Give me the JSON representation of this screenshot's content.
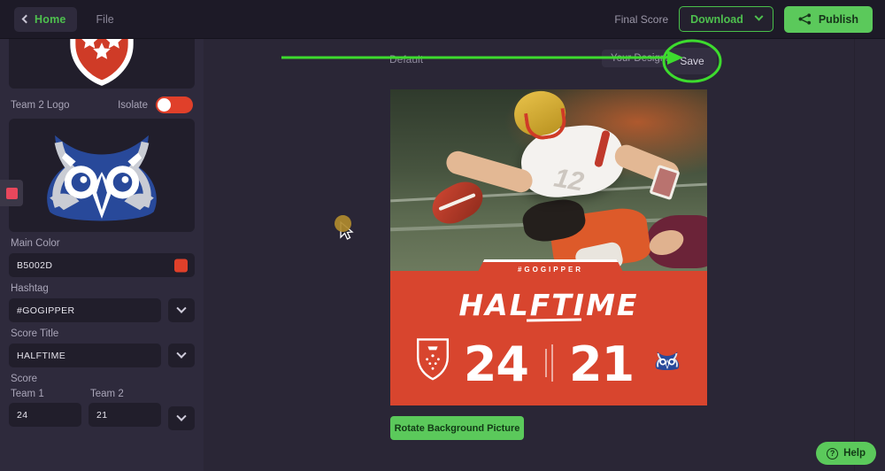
{
  "topbar": {
    "back_icon": "chevron-left-icon",
    "home_label": "Home",
    "file_label": "File",
    "final_score_label": "Final Score",
    "download_label": "Download",
    "download_caret_icon": "chevron-down-icon",
    "publish_label": "Publish",
    "publish_icon": "share-icon",
    "accent_green": "#4ec04e",
    "publish_bg": "#5bc95b"
  },
  "sidebar": {
    "team1_logo_alt": "red-shield-with-stars",
    "team2_logo_label": "Team 2 Logo",
    "isolate_label": "Isolate",
    "isolate_on": true,
    "isolate_color": "#e0402a",
    "team2_logo_alt": "blue-owl-head",
    "edge_chip_color": "#e8475c",
    "main_color_label": "Main Color",
    "main_color_value": "B5002D",
    "main_color_swatch": "#e0402a",
    "hashtag_label": "Hashtag",
    "hashtag_value": "#GOGIPPER",
    "score_title_label": "Score Title",
    "score_title_value": "HALFTIME",
    "score_label": "Score",
    "team1_label": "Team 1",
    "team2_label": "Team 2",
    "team1_score": "24",
    "team2_score": "21",
    "dropdown_icon": "chevron-down-icon"
  },
  "canvas": {
    "default_label": "Default",
    "your_designs_label": "Your Designs",
    "save_label": "Save",
    "annotation_color": "#3ddb2e",
    "rotate_button_label": "Rotate Background Picture"
  },
  "graphic": {
    "hashtag": "#GOGIPPER",
    "score_title": "HALFTIME",
    "team1_score": "24",
    "team2_score": "21",
    "team1_logo_alt": "red-shield-with-stars",
    "team2_logo_alt": "blue-owl-head",
    "background_color": "#d8452e",
    "photo_alt": "football-player-reaching-with-ball"
  },
  "help": {
    "label": "Help",
    "icon": "question-mark-icon"
  }
}
